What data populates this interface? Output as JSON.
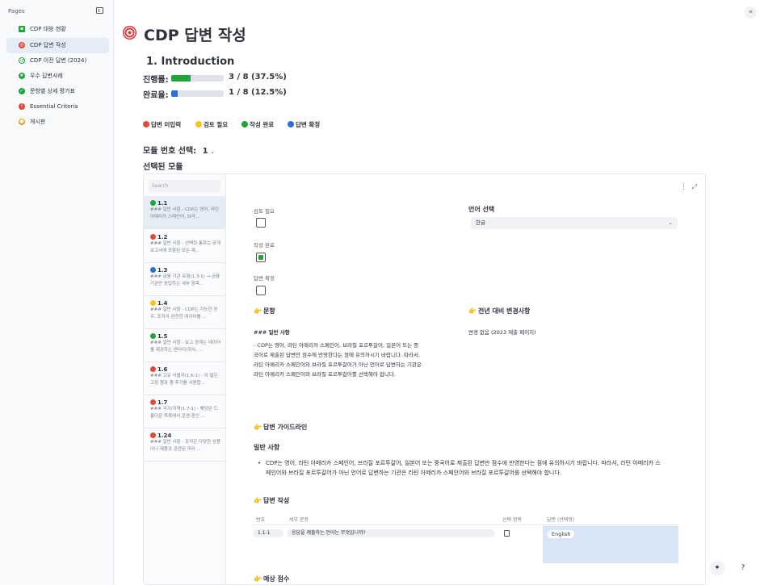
{
  "sidebar": {
    "heading": "Pages",
    "items": [
      {
        "label": "CDP 대응 현황",
        "icon": "chart-square-icon",
        "color": "#22a33a"
      },
      {
        "label": "CDP 답변 작성",
        "icon": "target-icon",
        "color": "#e04a3a"
      },
      {
        "label": "CDP 이전 답변 (2024)",
        "icon": "history-icon",
        "color": "#22a33a"
      },
      {
        "label": "우수 답변사례",
        "icon": "star-badge-icon",
        "color": "#22a33a"
      },
      {
        "label": "문항별 상세 평가표",
        "icon": "check-circle-icon",
        "color": "#22a33a"
      },
      {
        "label": "Essential Criteria",
        "icon": "alert-icon",
        "color": "#e04a3a"
      },
      {
        "label": "게시판",
        "icon": "palette-icon",
        "color": "#f0a020"
      }
    ]
  },
  "page": {
    "title": "CDP 답변 작성",
    "section_heading": "1. Introduction",
    "progress": {
      "label": "진행률:",
      "value_text": "3 / 8 (37.5%)",
      "fraction": 0.375,
      "color": "#22a33a"
    },
    "completion": {
      "label": "완료율:",
      "value_text": "1 / 8 (12.5%)",
      "fraction": 0.125,
      "color": "#2b6fd6"
    },
    "legend": [
      {
        "label": "답변 미입력",
        "color": "#e04a3a"
      },
      {
        "label": "검토 필요",
        "color": "#f5c518"
      },
      {
        "label": "작성 완료",
        "color": "#22a33a"
      },
      {
        "label": "답변 확정",
        "color": "#2b6fd6"
      }
    ],
    "module_select_label": "모듈 번호 선택:",
    "module_select_value": "1",
    "selected_module_label": "선택된 모듈"
  },
  "list": {
    "search_placeholder": "Search",
    "items": [
      {
        "num": "1.1",
        "color": "#22a33a",
        "text": "### 일반 사항 - CDP는 영어, 라틴 아메리카 스페인어, 브라..."
      },
      {
        "num": "1.2",
        "color": "#e04a3a",
        "text": "### 일반 사항 - 선택한 통화는 공개 보고서에 포함된 모든 재..."
      },
      {
        "num": "1.3",
        "color": "#2b6fd6",
        "text": "### 금융 기관 유형(1.3-1) → 금융기관만 응답하는 세부 항목..."
      },
      {
        "num": "1.4",
        "color": "#f5c518",
        "text": "### 일반 사항 - CDP는 가능한 경우, 조직이 완전한 데이터를 ..."
      },
      {
        "num": "1.5",
        "color": "#22a33a",
        "text": "### 일반 사항 - 보고 경계는 데이터를 제공하는 엔티티(회사, ..."
      },
      {
        "num": "1.6",
        "color": "#e04a3a",
        "text": "### 고유 식별자(1.6-1) - 이 열은 고정 행과 행 추가를 사용합..."
      },
      {
        "num": "1.7",
        "color": "#e04a3a",
        "text": "### 국가/지역(1.7-1) - 해당된 드롭다운 목록에서 운영 중인 ..."
      },
      {
        "num": "1.24",
        "color": "#e04a3a",
        "text": "### 일반 사항 - 조직은 다양한 상품이나 제품과 관련된 여러 ..."
      }
    ]
  },
  "detail": {
    "review_needed_label": "검토 필요",
    "review_needed_checked": false,
    "complete_label": "작성 완료",
    "complete_checked": true,
    "confirmed_label": "답변 확정",
    "confirmed_checked": false,
    "language_label": "언어 선택",
    "language_value": "한글",
    "question_heading": "문항",
    "question_sub": "### 일반 사항",
    "question_body": "- CDP는 영어, 라틴 아메리카 스페인어, 브라질 포르투갈어, 일본어 또는 중국어로 제출된 답변만 점수에 반영한다는 점에 유의하시기 바랍니다. 따라서, 라틴 아메리카 스페인어와 브라질 포르투갈어가 아닌 언어로 답변하는 기관은 라틴 아메리카 스페인어와 브라질 포르투갈어를 선택해야 합니다.",
    "changes_heading": "전년 대비 변경사항",
    "changes_body": "변경 없음 (2023 제출 페이지)",
    "guide_heading": "답변 가이드라인",
    "guide_sub": "일반 사항",
    "guide_bullet": "CDP는 영어, 라틴 아메리카 스페인어, 브라질 포르투갈어, 일본어 또는 중국어로 제출된 답변만 점수에 반영한다는 점에 유의하시기 바랍니다. 따라서, 라틴 아메리카 스페인어와 브라질 포르투갈어가 아닌 언어로 답변하는 기관은 라틴 아메리카 스페인어와 브라질 포르투갈어를 선택해야 합니다.",
    "answer_heading": "답변 작성",
    "table_headers": [
      "번호",
      "세부 문항",
      "선택 항목",
      "답변 (선택형)"
    ],
    "table_row": {
      "num": "1.1-1",
      "question": "응답을 제출하는 언어는 무엇입니까?",
      "answer": "English"
    },
    "score_heading": "예상 점수"
  }
}
